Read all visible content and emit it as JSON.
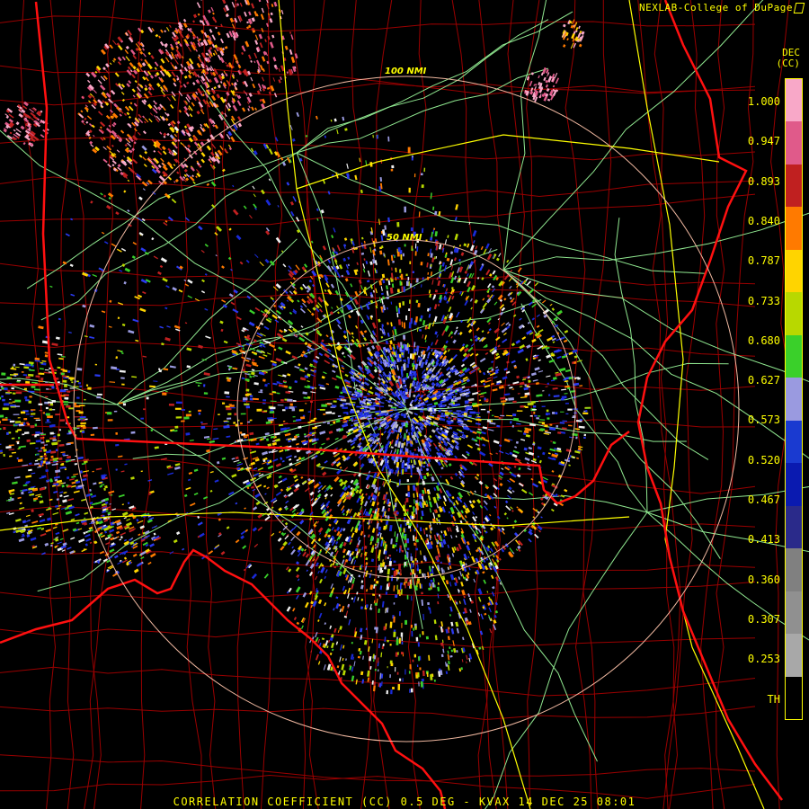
{
  "header": {
    "credit": "NEXLAB-College of DuPage",
    "logo": "cod-logo-icon"
  },
  "footer": {
    "product_title": "CORRELATION COEFFICIENT (CC) 0.5 DEG - KVAX 14 DEC 25 08:01"
  },
  "legend": {
    "time_label": "DEC",
    "units": "(CC)",
    "tick_labels": [
      "1.000",
      "0.947",
      "0.893",
      "0.840",
      "0.787",
      "0.733",
      "0.680",
      "0.627",
      "0.573",
      "0.520",
      "0.467",
      "0.413",
      "0.360",
      "0.307",
      "0.253",
      "TH"
    ],
    "colors": [
      "#f8a8c8",
      "#e05a8a",
      "#c02020",
      "#ff7a00",
      "#ffd400",
      "#b8d800",
      "#3ad02a",
      "#9a9ae0",
      "#1a3ad0",
      "#0a1ab0",
      "#2a2a8a",
      "#808080",
      "#909090",
      "#a8a8a8",
      "#000000"
    ]
  },
  "map": {
    "range_rings": [
      "100 NMI",
      "50 NMI"
    ],
    "colors": {
      "state_lines": "#ff0000",
      "county_lines": "#a00000",
      "highways": "#a0ffa0",
      "interstates": "#ffff00",
      "rings": "#f0c0a0"
    }
  }
}
